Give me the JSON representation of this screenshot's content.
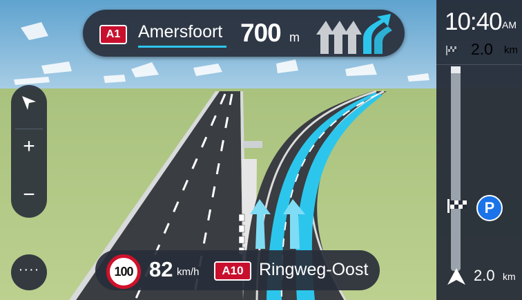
{
  "instruction": {
    "road_number": "A1",
    "street": "Amersfoort",
    "distance": "700",
    "unit": "m"
  },
  "right_panel": {
    "time": "10:40",
    "ampm": "AM",
    "arrival_distance": "2.0",
    "arrival_unit": "km",
    "next_stop_distance": "2.0",
    "next_stop_unit": "km",
    "parking_label": "P"
  },
  "controls": {
    "zoom_in": "+",
    "zoom_out": "−",
    "menu": "····"
  },
  "bottom_bar": {
    "speed_limit": "100",
    "current_speed": "82",
    "speed_unit": "km/h",
    "road_number": "A10",
    "street": "Ringweg-Oost"
  },
  "colors": {
    "road_shield": "#c8102e",
    "route_highlight": "#2cc6ec",
    "parking_blue": "#1a73e8",
    "panel_dark": "#282e3a",
    "grass": "#b7ca84"
  },
  "icons": [
    "compass-arrow-icon",
    "lane-guidance-icon",
    "checkered-flag-icon",
    "parking-icon",
    "current-position-arrow-icon",
    "more-menu-icon"
  ]
}
